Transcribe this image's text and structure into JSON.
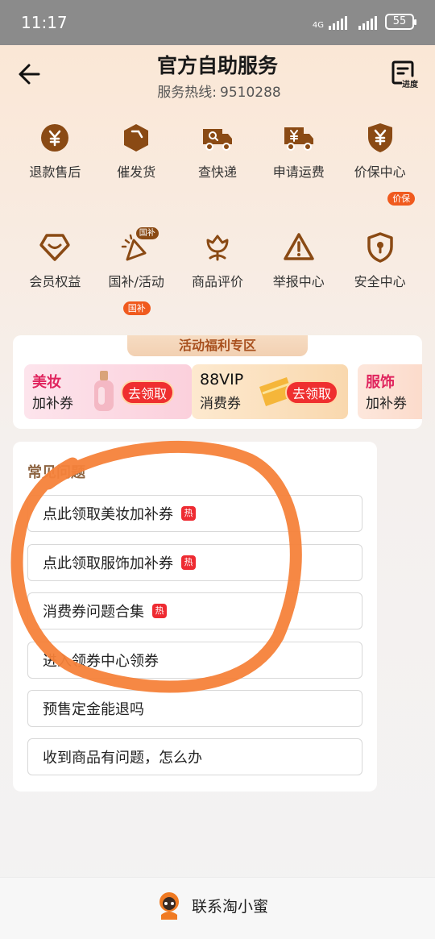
{
  "status_bar": {
    "time": "11:17",
    "network": "4G",
    "battery": "55"
  },
  "header": {
    "title": "官方自助服务",
    "hotline_label": "服务热线:",
    "hotline_number": "9510288",
    "progress_label": "进度"
  },
  "services_row1": [
    {
      "label": "退款售后",
      "icon": "refund-yuan-icon"
    },
    {
      "label": "催发货",
      "icon": "ship-urge-icon"
    },
    {
      "label": "查快递",
      "icon": "delivery-truck-icon"
    },
    {
      "label": "申请运费",
      "icon": "freight-truck-icon"
    },
    {
      "label": "价保中心",
      "icon": "price-protect-shield-icon",
      "tag": "价保"
    }
  ],
  "services_row2": [
    {
      "label": "会员权益",
      "icon": "member-smile-icon"
    },
    {
      "label": "国补/活动",
      "icon": "party-popper-icon",
      "tag": "国补",
      "badge": "国补"
    },
    {
      "label": "商品评价",
      "icon": "flower-icon"
    },
    {
      "label": "举报中心",
      "icon": "warning-icon"
    },
    {
      "label": "安全中心",
      "icon": "shield-lock-icon"
    }
  ],
  "promo": {
    "header": "活动福利专区",
    "coupons": [
      {
        "line1": "美妆",
        "line2": "加补券",
        "button": "去领取"
      },
      {
        "line1": "88VIP",
        "line2": "消费券",
        "button": "去领取"
      },
      {
        "line1": "服饰",
        "line2": "加补券"
      }
    ]
  },
  "faq": {
    "title": "常见问题",
    "items": [
      {
        "text": "点此领取美妆加补券",
        "hot": "热"
      },
      {
        "text": "点此领取服饰加补券",
        "hot": "热"
      },
      {
        "text": "消费券问题合集",
        "hot": "热"
      },
      {
        "text": "进入领券中心领券"
      },
      {
        "text": "预售定金能退吗"
      },
      {
        "text": "收到商品有问题，怎么办"
      }
    ]
  },
  "bottom": {
    "contact_label": "联系淘小蜜"
  },
  "colors": {
    "brand_brown": "#8a4a14",
    "accent_red": "#ef2f2f",
    "annotation_orange": "#f5823a"
  }
}
